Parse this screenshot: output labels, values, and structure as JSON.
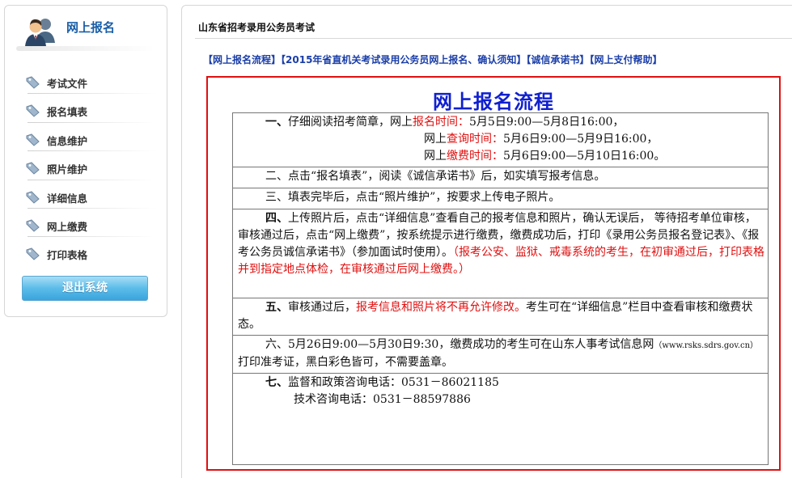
{
  "sidebar": {
    "title": "网上报名",
    "items": [
      {
        "label": "考试文件"
      },
      {
        "label": "报名填表"
      },
      {
        "label": "信息维护"
      },
      {
        "label": "照片维护"
      },
      {
        "label": "详细信息"
      },
      {
        "label": "网上缴费"
      },
      {
        "label": "打印表格"
      }
    ],
    "logout_label": "退出系统"
  },
  "main": {
    "title": "山东省招考录用公务员考试",
    "links": [
      "【网上报名流程】",
      "【2015年省直机关考试录用公务员网上报名、确认须知】",
      "【诚信承诺书】",
      "【网上支付帮助】"
    ],
    "box_title": "网上报名流程",
    "steps": {
      "s1_num": "一、",
      "s1_text": "仔细阅读招考简章，",
      "s1_l1_a": "网上",
      "s1_l1_b": "报名时间：",
      "s1_l1_c": "5月5日9:00—5月8日16:00，",
      "s1_l2_a": "网上",
      "s1_l2_b": "查询时间：",
      "s1_l2_c": "5月6日9:00—5月9日16:00，",
      "s1_l3_a": "网上",
      "s1_l3_b": "缴费时间：",
      "s1_l3_c": "5月6日9:00—5月10日16:00。",
      "s2": "二、点击“报名填表”，阅读《诚信承诺书》后，如实填写报考信息。",
      "s3": "三、填表完毕后，点击“照片维护”，按要求上传电子照片。",
      "s4_num": "四、",
      "s4_text": "上传照片后，点击“详细信息”查看自己的报考信息和照片，确认无误后， 等待招考单位审核，审核通过后，点击“网上缴费”，按系统提示进行缴费，缴费成功后，打印《录用公务员报名登记表》、《报考公务员诚信承诺书》（参加面试时使用）。",
      "s4_red": "（报考公安、监狱、戒毒系统的考生，在初审通过后，打印表格并到指定地点体检，在审核通过后网上缴费。）",
      "s5_num": "五、",
      "s5_a": "审核通过后，",
      "s5_red": "报考信息和照片将不再允许修改。",
      "s5_b": "考生可在“详细信息”栏目中查看审核和缴费状态。",
      "s6_a": "六、5月26日9:00—5月30日9:30，缴费成功的考生可在山东人事考试信息网",
      "s6_url": "（www.rsks.sdrs.gov.cn）",
      "s6_b": "打印准考证，黑白彩色皆可，不需要盖章。",
      "s7_num": "七、",
      "s7_l1": "监督和政策咨询电话：0531－86021185",
      "s7_l2": "技术咨询电话：0531－88597886"
    }
  },
  "colors": {
    "accent_blue": "#1020d0",
    "link_blue": "#1a3ea8",
    "highlight_red": "#e01010",
    "button_blue": "#3aa4dd"
  },
  "icons": [
    "users-icon",
    "tag-icon"
  ]
}
